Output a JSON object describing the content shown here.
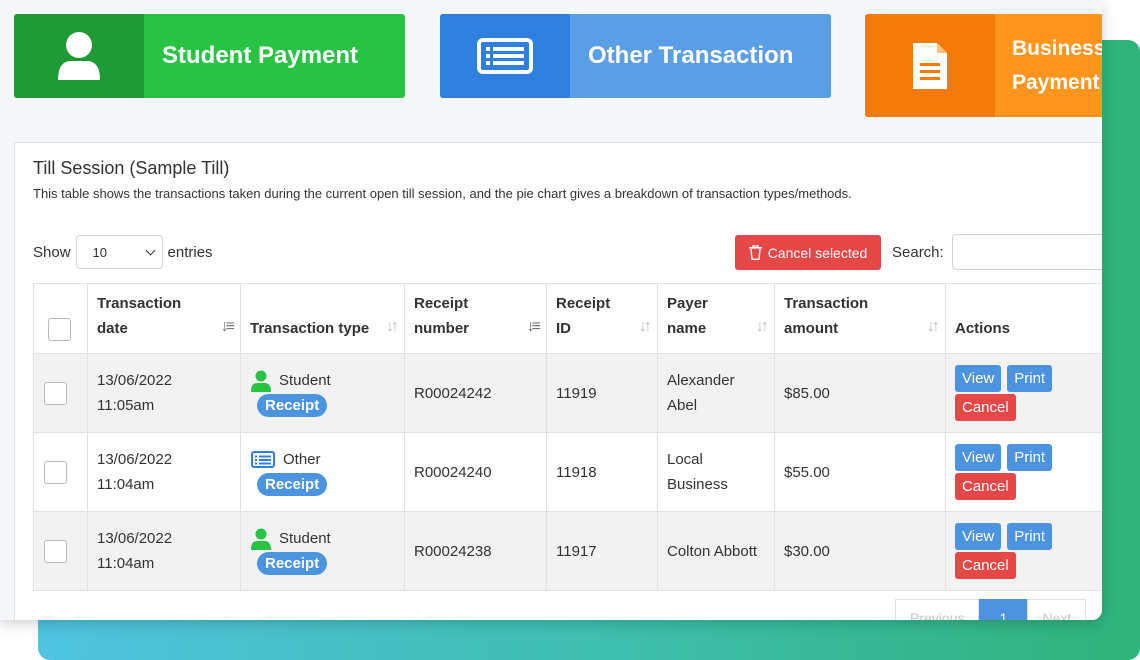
{
  "tiles": {
    "student": {
      "label": "Student Payment",
      "color": "#28c245"
    },
    "other": {
      "label": "Other Transaction",
      "color": "#5b9ee8"
    },
    "business": {
      "label_line1": "Business",
      "label_line2": "Payment",
      "color": "#ff941f"
    }
  },
  "card": {
    "title": "Till Session (Sample Till)",
    "description": "This table shows the transactions taken during the current open till session, and the pie chart gives a breakdown of transaction types/methods."
  },
  "controls": {
    "show_label": "Show",
    "entries_value": "10",
    "entries_label": "entries",
    "cancel_selected_label": "Cancel selected",
    "search_label": "Search:",
    "search_value": ""
  },
  "table": {
    "headers": {
      "date_line1": "Transaction",
      "date_line2": "date",
      "type": "Transaction type",
      "receipt_line1": "Receipt",
      "receipt_line2": "number",
      "rid_line1": "Receipt",
      "rid_line2": "ID",
      "payer_line1": "Payer",
      "payer_line2": "name",
      "amount_line1": "Transaction",
      "amount_line2": "amount",
      "actions": "Actions"
    },
    "rows": [
      {
        "date": "13/06/2022",
        "time": "11:05am",
        "type": "Student",
        "type_icon": "user-icon",
        "badge": "Receipt",
        "receipt_number": "R00024242",
        "receipt_id": "11919",
        "payer_line1": "Alexander",
        "payer_line2": "Abel",
        "amount": "$85.00"
      },
      {
        "date": "13/06/2022",
        "time": "11:04am",
        "type": "Other",
        "type_icon": "list-card-icon",
        "badge": "Receipt",
        "receipt_number": "R00024240",
        "receipt_id": "11918",
        "payer_line1": "Local",
        "payer_line2": "Business",
        "amount": "$55.00"
      },
      {
        "date": "13/06/2022",
        "time": "11:04am",
        "type": "Student",
        "type_icon": "user-icon",
        "badge": "Receipt",
        "receipt_number": "R00024238",
        "receipt_id": "11917",
        "payer_line1": "Colton Abbott",
        "payer_line2": "",
        "amount": "$30.00"
      }
    ],
    "action_labels": {
      "view": "View",
      "print": "Print",
      "cancel": "Cancel"
    }
  },
  "pagination": {
    "previous": "Previous",
    "current": "1",
    "next": "Next"
  },
  "colors": {
    "accent": "#4c93e0",
    "danger": "#e64848",
    "success": "#28c245",
    "warning": "#ff941f"
  }
}
